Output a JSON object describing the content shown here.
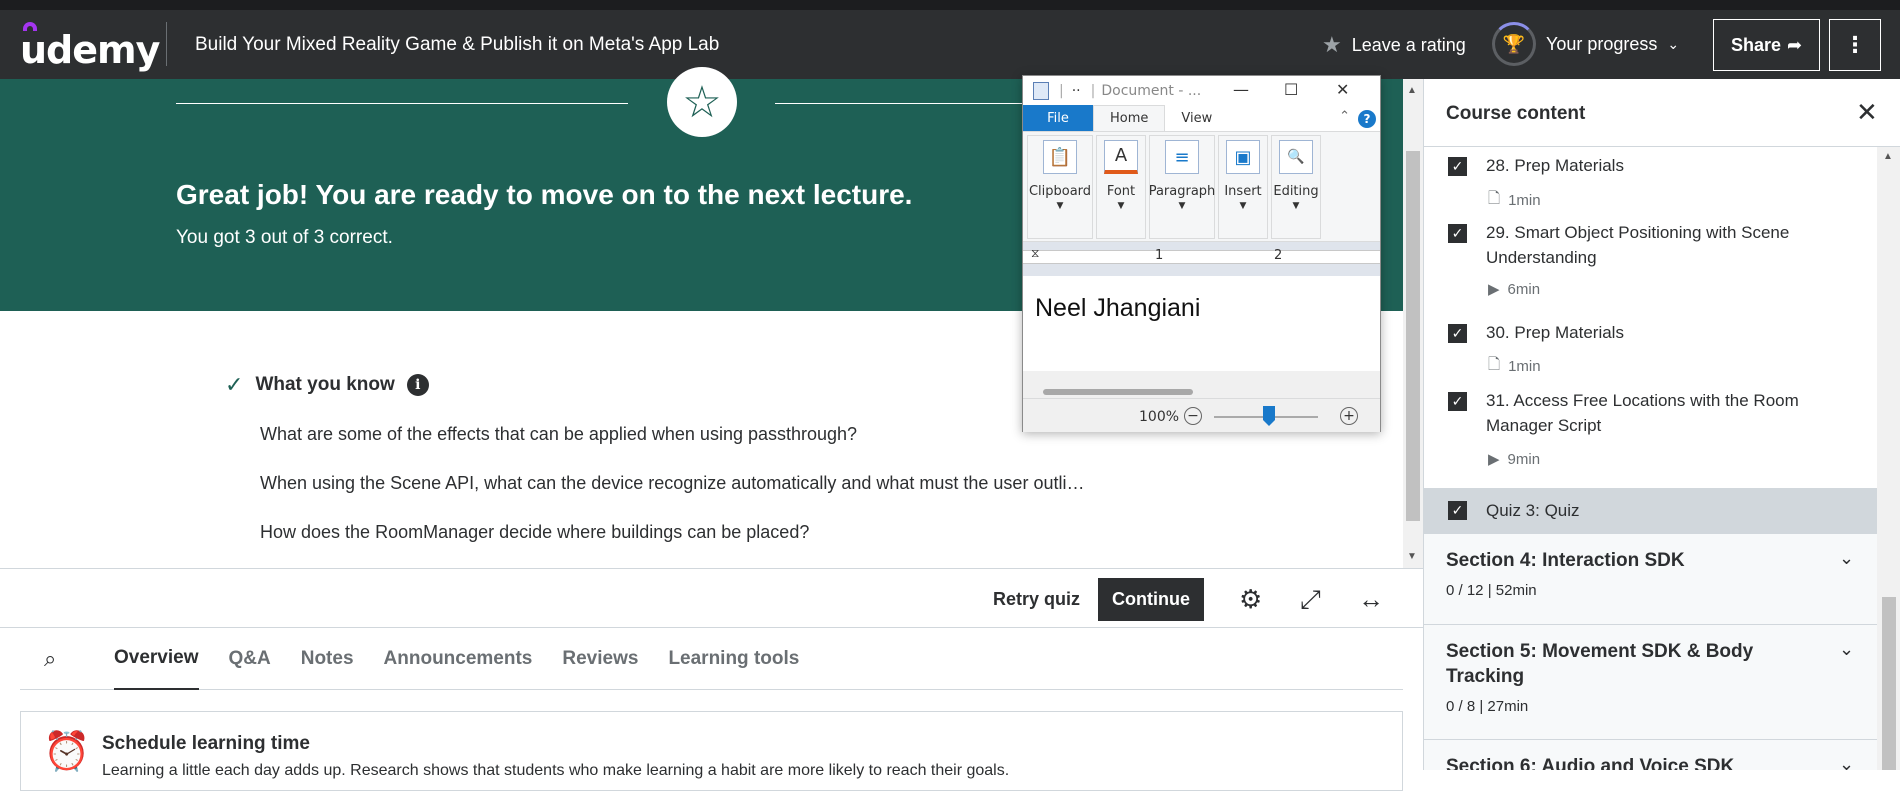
{
  "header": {
    "logo": "udemy",
    "course_title": "Build Your Mixed Reality Game & Publish it on Meta's App Lab",
    "rating_label": "Leave a rating",
    "rating_icon": "star-icon",
    "progress_label": "Your progress",
    "progress_icon": "trophy-icon",
    "share_label": "Share",
    "more_icon": "kebab-menu-icon"
  },
  "banner": {
    "heading": "Great job! You are ready to move on to the next lecture.",
    "score": "You got 3 out of 3 correct.",
    "badge_icon": "star-icon"
  },
  "know": {
    "heading": "What you know",
    "items": [
      "What are some of the effects that can be applied when using passthrough?",
      "When using the Scene API, what can the device recognize automatically and what must the user outli…",
      "How does the RoomManager decide where buildings can be placed?"
    ]
  },
  "quizbar": {
    "retry_label": "Retry quiz",
    "continue_label": "Continue"
  },
  "tabs": [
    "Overview",
    "Q&A",
    "Notes",
    "Announcements",
    "Reviews",
    "Learning tools"
  ],
  "active_tab": "Overview",
  "schedule": {
    "title": "Schedule learning time",
    "desc": "Learning a little each day adds up. Research shows that students who make learning a habit are more likely to reach their goals."
  },
  "wordpad": {
    "title": "Document - ...",
    "title_sep": "|",
    "qat": "··",
    "menu": {
      "file": "File",
      "home": "Home",
      "view": "View",
      "help": "?"
    },
    "groups": [
      {
        "label": "Clipboard",
        "icon": "clipboard-icon",
        "glyph": "📋"
      },
      {
        "label": "Font",
        "icon": "font-icon",
        "glyph": "A"
      },
      {
        "label": "Paragraph",
        "icon": "paragraph-icon",
        "glyph": "≡"
      },
      {
        "label": "Insert",
        "icon": "picture-icon",
        "glyph": "▣"
      },
      {
        "label": "Editing",
        "icon": "binoculars-icon",
        "glyph": "🔍"
      }
    ],
    "ruler": [
      "1",
      "2"
    ],
    "document_text": "Neel Jhangiani",
    "zoom": "100%"
  },
  "panel": {
    "title": "Course content",
    "lectures": [
      {
        "title": "28. Prep Materials",
        "duration": "1min",
        "kind": "file-icon"
      },
      {
        "title": "29. Smart Object Positioning with Scene Understanding",
        "duration": "6min",
        "kind": "video-icon"
      },
      {
        "title": "30. Prep Materials",
        "duration": "1min",
        "kind": "file-icon"
      },
      {
        "title": "31. Access Free Locations with the Room Manager Script",
        "duration": "9min",
        "kind": "video-icon"
      },
      {
        "title": "Quiz 3: Quiz",
        "duration": "",
        "kind": ""
      }
    ],
    "sections": [
      {
        "title": "Section 4: Interaction SDK",
        "sub": "0 / 12 | 52min"
      },
      {
        "title": "Section 5: Movement SDK & Body Tracking",
        "sub": "0 / 8 | 27min"
      },
      {
        "title": "Section 6: Audio and Voice SDK",
        "sub": ""
      }
    ]
  }
}
